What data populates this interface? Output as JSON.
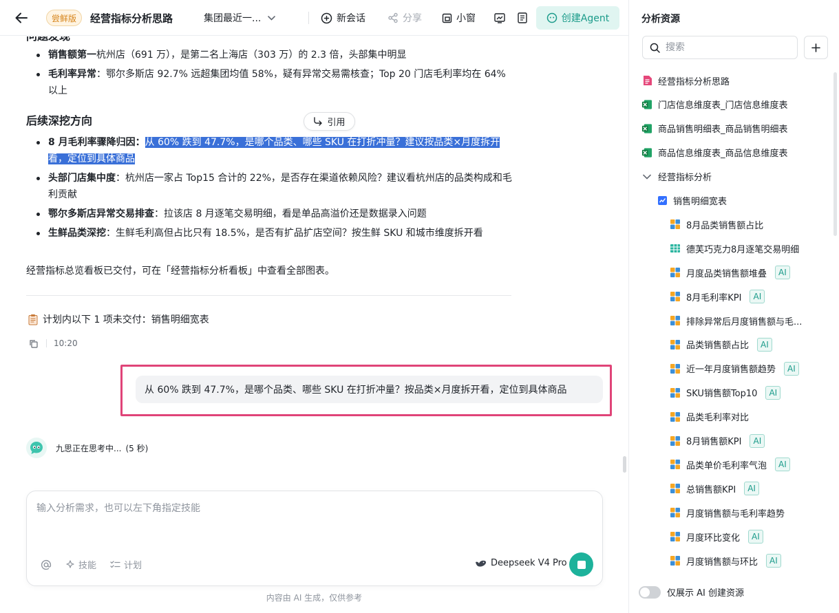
{
  "topbar": {
    "trial_badge": "尝鲜版",
    "title": "经营指标分析思路",
    "context_select": "集团最近一...",
    "new_chat": "新会话",
    "share": "分享",
    "mini_window": "小窗",
    "create_agent": "创建Agent"
  },
  "chat": {
    "cut_heading": "问题发现",
    "findings": [
      {
        "label": "销售额第一",
        "text": "杭州店（691 万），是第二名上海店（303 万）的 2.3 倍，头部集中明显"
      },
      {
        "label": "毛利率异常",
        "text": "：鄂尔多斯店 92.7% 远超集团均值 58%，疑有异常交易需核查；Top 20 门店毛利率均在 64% 以上"
      }
    ],
    "next_heading": "后续深挖方向",
    "cite_label": "引用",
    "directions": [
      {
        "label": "8 月毛利率骤降归因",
        "sep": "：",
        "text": "从 60% 跌到 47.7%，是哪个品类、哪些 SKU 在打折冲量？建议按品类×月度拆开看，定位到具体商品"
      },
      {
        "label": "头部门店集中度",
        "sep": "：",
        "text": "杭州店一家占 Top15 合计的 22%，是否存在渠道依赖风险？建议看杭州店的品类构成和毛利贡献"
      },
      {
        "label": "鄂尔多斯店异常交易排查",
        "sep": "：",
        "text": "拉该店 8 月逐笔交易明细，看是单品高溢价还是数据录入问题"
      },
      {
        "label": "生鲜品类深挖",
        "sep": "：",
        "text": "生鲜毛利高但占比只有 18.5%，是否有扩品扩店空间？按生鲜 SKU 和城市维度拆开看"
      }
    ],
    "delivered_note": "经营指标总览看板已交付，可在「经营指标分析看板」中查看全部图表。",
    "plan_note": "计划内以下 1 项未交付：销售明细宽表",
    "timestamp": "10:20",
    "user_message": "从 60% 跌到 47.7%，是哪个品类、哪些 SKU 在打折冲量？按品类×月度拆开看，定位到具体商品",
    "thinking": "九思正在思考中...",
    "thinking_seconds": "(5 秒)"
  },
  "composer": {
    "placeholder": "输入分析需求，也可以左下角指定技能",
    "skill": "技能",
    "plan": "计划",
    "model": "Deepseek V4 Pro",
    "disclaimer": "内容由 AI 生成，仅供参考"
  },
  "sidebar": {
    "title": "分析资源",
    "search_placeholder": "搜索",
    "ai_tag": "AI",
    "items": [
      {
        "label": "经营指标分析思路",
        "icon": "doc-icon",
        "indent": 0,
        "ai": false
      },
      {
        "label": "门店信息维度表_门店信息维度表",
        "icon": "excel-icon",
        "indent": 0,
        "ai": false
      },
      {
        "label": "商品销售明细表_商品销售明细表",
        "icon": "excel-icon",
        "indent": 0,
        "ai": false
      },
      {
        "label": "商品信息维度表_商品信息维度表",
        "icon": "excel-icon",
        "indent": 0,
        "ai": false
      },
      {
        "label": "经营指标分析",
        "icon": "chevron-down-icon",
        "indent": 0,
        "ai": false
      },
      {
        "label": "销售明细宽表",
        "icon": "dataset-icon",
        "indent": 1,
        "ai": false
      },
      {
        "label": "8月品类销售额占比",
        "icon": "chart-icon",
        "indent": 2,
        "ai": false
      },
      {
        "label": "德芙巧克力8月逐笔交易明细",
        "icon": "table-icon",
        "indent": 2,
        "ai": false
      },
      {
        "label": "月度品类销售额堆叠",
        "icon": "chart-icon",
        "indent": 2,
        "ai": true
      },
      {
        "label": "8月毛利率KPI",
        "icon": "chart-icon",
        "indent": 2,
        "ai": true
      },
      {
        "label": "排除异常后月度销售额与毛...",
        "icon": "chart-icon",
        "indent": 2,
        "ai": false
      },
      {
        "label": "品类销售额占比",
        "icon": "chart-icon",
        "indent": 2,
        "ai": true
      },
      {
        "label": "近一年月度销售额趋势",
        "icon": "chart-icon",
        "indent": 2,
        "ai": true
      },
      {
        "label": "SKU销售额Top10",
        "icon": "chart-icon",
        "indent": 2,
        "ai": true
      },
      {
        "label": "品类毛利率对比",
        "icon": "chart-icon",
        "indent": 2,
        "ai": false
      },
      {
        "label": "8月销售额KPI",
        "icon": "chart-icon",
        "indent": 2,
        "ai": true
      },
      {
        "label": "品类单价毛利率气泡",
        "icon": "chart-icon",
        "indent": 2,
        "ai": true
      },
      {
        "label": "总销售额KPI",
        "icon": "chart-icon",
        "indent": 2,
        "ai": true
      },
      {
        "label": "月度销售额与毛利率趋势",
        "icon": "chart-icon",
        "indent": 2,
        "ai": false
      },
      {
        "label": "月度环比变化",
        "icon": "chart-icon",
        "indent": 2,
        "ai": true
      },
      {
        "label": "月度销售额与环比",
        "icon": "chart-icon",
        "indent": 2,
        "ai": true
      }
    ],
    "toggle_label": "仅展示 AI 创建资源",
    "toggle_on": false
  },
  "colors": {
    "accent": "#1db29b",
    "highlight": "#3a70d8",
    "focus_box": "#e04478",
    "trial_badge": "#d68318"
  }
}
